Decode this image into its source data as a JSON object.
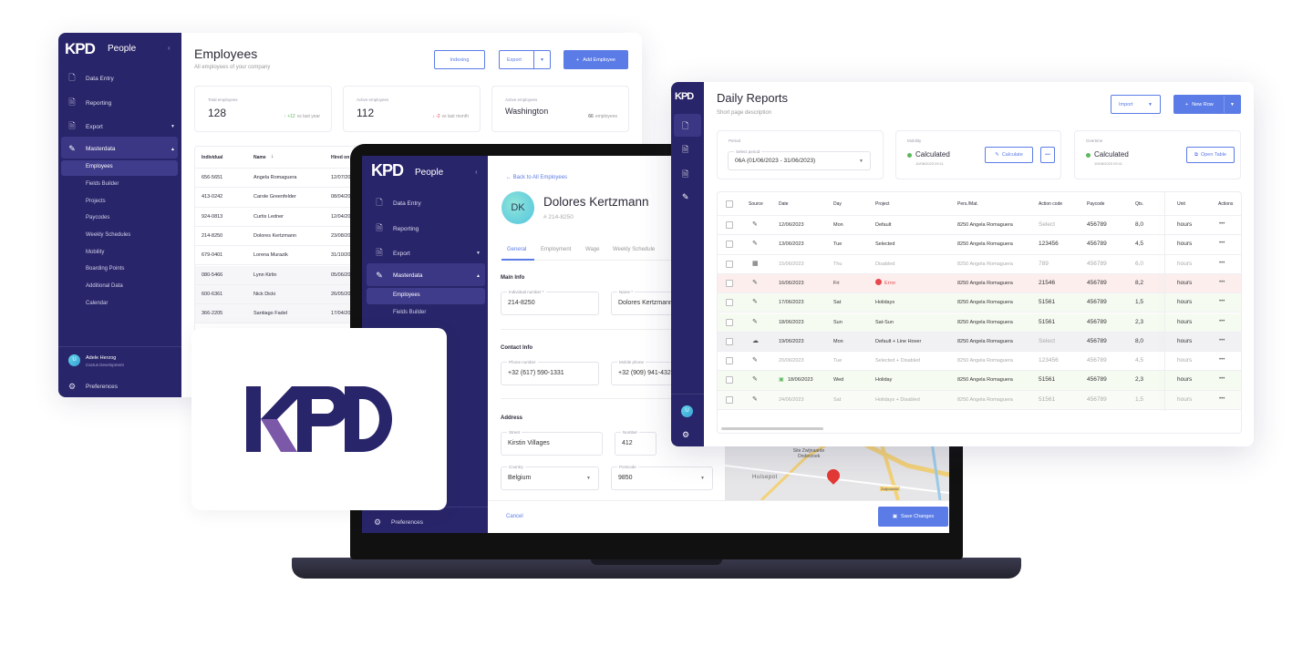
{
  "colors": {
    "sidebar": "#29256a",
    "accent": "#5b7ce6",
    "logo_purple": "#7c58a8",
    "error": "#e5484d",
    "success": "#5cb85c"
  },
  "brand": {
    "logo": "KPD",
    "app": "People"
  },
  "employees_panel": {
    "sidebar": {
      "items": [
        {
          "label": "Data Entry",
          "icon": "file-edit-icon"
        },
        {
          "label": "Reporting",
          "icon": "report-icon"
        },
        {
          "label": "Export",
          "icon": "export-icon"
        },
        {
          "label": "Masterdata",
          "icon": "edit-square-icon"
        }
      ],
      "subitems": [
        "Employees",
        "Fields Builder",
        "Projects",
        "Paycodes",
        "Weekly Schedules",
        "Mobility",
        "Boarding Points",
        "Additional Data",
        "Calendar"
      ],
      "user": {
        "initial": "U",
        "name": "Adele Herzog",
        "company": "Cactus Development"
      },
      "preferences": "Preferences"
    },
    "title": "Employees",
    "subtitle": "All employees of your company",
    "buttons": {
      "indexing": "Indexing",
      "export": "Export",
      "add": "Add Employee"
    },
    "stats": [
      {
        "label": "Total employees",
        "value": "128",
        "delta": "+12",
        "delta_note": "vs last year",
        "trend": "up"
      },
      {
        "label": "Active employees",
        "value": "112",
        "delta": "-2",
        "delta_note": "vs last month",
        "trend": "down"
      },
      {
        "label": "Active employees",
        "value": "Washington",
        "delta": "66",
        "delta_note": "employees"
      }
    ],
    "table": {
      "headers": [
        "Individual",
        "Name",
        "Hired on"
      ],
      "rows": [
        [
          "656-5651",
          "Angela Romaguera",
          "12/07/20"
        ],
        [
          "413-0242",
          "Carole Greenfelder",
          "08/04/20"
        ],
        [
          "924-0813",
          "Curtis Ledner",
          "12/04/20"
        ],
        [
          "214-8250",
          "Dolores Kertzmann",
          "23/08/20"
        ],
        [
          "679-0401",
          "Lorena Murazik",
          "31/10/20"
        ],
        [
          "080-5466",
          "Lynn Kirlin",
          "05/06/20"
        ],
        [
          "600-6361",
          "Nick Dicki",
          "26/05/20"
        ],
        [
          "366-2205",
          "Santiago Fadel",
          "17/04/20"
        ]
      ]
    }
  },
  "detail_panel": {
    "sidebar": {
      "items": [
        "Data Entry",
        "Reporting",
        "Export",
        "Masterdata"
      ],
      "subitems": [
        "Employees",
        "Fields Builder"
      ],
      "preferences": "Preferences"
    },
    "back": "Back to All Employees",
    "initials": "DK",
    "name": "Dolores Kertzmann",
    "id": "# 214-8250",
    "tabs": [
      "General",
      "Employment",
      "Wage",
      "Weekly Schedule"
    ],
    "active_tab": "General",
    "sections": {
      "main": "Main Info",
      "contact": "Contact Info",
      "address": "Address"
    },
    "fields": {
      "individual_label": "Individual number *",
      "individual": "214-8250",
      "name_label": "Name *",
      "name": "Dolores Kertzmann",
      "phone_label": "Phone number",
      "phone": "+32 (617) 590-1331",
      "mobile_label": "Mobile phone",
      "mobile": "+32 (909) 941-432",
      "street_label": "Street",
      "street": "Kirstin Villages",
      "number_label": "Number",
      "number": "412",
      "country_label": "Country",
      "country": "Belgium",
      "postcode_label": "Postcode",
      "postcode": "9850"
    },
    "map": {
      "labels": [
        "Site Zwijnaarde Onderzoek",
        "Hulsepot",
        "Zwijnaarde"
      ]
    },
    "cancel": "Cancel",
    "save": "Save Changes"
  },
  "reports_panel": {
    "title": "Daily Reports",
    "subtitle": "Short page description",
    "buttons": {
      "import": "Import",
      "new_row": "New Row",
      "calculate": "Calculate",
      "open_table": "Open Table"
    },
    "period": {
      "label": "Period",
      "select_label": "Select period",
      "value": "06A (01/06/2023 - 31/06/2023)"
    },
    "mobility": {
      "label": "Mobility",
      "status": "Calculated",
      "time": "10/08/2023 09:11"
    },
    "overtime": {
      "label": "Overtime",
      "status": "Calculated",
      "time": "10/08/2023 09:11"
    },
    "user_initial": "U",
    "table": {
      "headers": [
        "Source",
        "Date",
        "Day",
        "Project",
        "Pers./Mat.",
        "Action code",
        "Paycode",
        "Qts.",
        "Unit",
        "Actions"
      ],
      "rows": [
        {
          "source": "pencil",
          "date": "12/06/2023",
          "day": "Mon",
          "project": "Default",
          "pers": "8250 Angela Romaguera",
          "action": "Select",
          "paycode": "456789",
          "qty": "8,0",
          "unit": "hours",
          "state": "normal"
        },
        {
          "source": "pencil",
          "date": "13/06/2023",
          "day": "Tue",
          "project": "Selected",
          "pers": "8250 Angela Romaguera",
          "action": "123456",
          "paycode": "456789",
          "qty": "4,5",
          "unit": "hours",
          "state": "normal"
        },
        {
          "source": "calendar",
          "date": "15/06/2023",
          "day": "Thu",
          "project": "Disabled",
          "pers": "8250 Angela Romaguera",
          "action": "789",
          "paycode": "456789",
          "qty": "6,0",
          "unit": "hours",
          "state": "disabled"
        },
        {
          "source": "pencil",
          "date": "16/06/2023",
          "day": "Fri",
          "project": "Error",
          "pers": "8250 Angela Romaguera",
          "action": "21546",
          "paycode": "456789",
          "qty": "8,2",
          "unit": "hours",
          "state": "error"
        },
        {
          "source": "pencil",
          "date": "17/06/2023",
          "day": "Sat",
          "project": "Holidays",
          "pers": "8250 Angela Romaguera",
          "action": "51561",
          "paycode": "456789",
          "qty": "1,5",
          "unit": "hours",
          "state": "holiday"
        },
        {
          "source": "pencil",
          "date": "18/06/2023",
          "day": "Sun",
          "project": "Sat-Sun",
          "pers": "8250 Angela Romaguera",
          "action": "51561",
          "paycode": "456789",
          "qty": "2,3",
          "unit": "hours",
          "state": "holiday"
        },
        {
          "source": "cloud",
          "date": "19/06/2023",
          "day": "Mon",
          "project": "Default + Line Hover",
          "pers": "8250 Angela Romaguera",
          "action": "Select",
          "paycode": "456789",
          "qty": "8,0",
          "unit": "hours",
          "state": "hover"
        },
        {
          "source": "pencil",
          "date": "20/06/2023",
          "day": "Tue",
          "project": "Selected + Disabled",
          "pers": "8250 Angela Romaguera",
          "action": "123456",
          "paycode": "456789",
          "qty": "4,5",
          "unit": "hours",
          "state": "disabled"
        },
        {
          "source": "pencil",
          "date": "18/06/2023",
          "day": "Wed",
          "project": "Holiday",
          "pers": "8250 Angela Romaguera",
          "action": "51561",
          "paycode": "456789",
          "qty": "2,3",
          "unit": "hours",
          "state": "holiday",
          "date_icon": true
        },
        {
          "source": "pencil",
          "date": "24/06/2023",
          "day": "Sat",
          "project": "Holidays + Disabled",
          "pers": "8250 Angela Romaguera",
          "action": "51561",
          "paycode": "456789",
          "qty": "1,5",
          "unit": "hours",
          "state": "holiday-disabled"
        }
      ]
    }
  }
}
